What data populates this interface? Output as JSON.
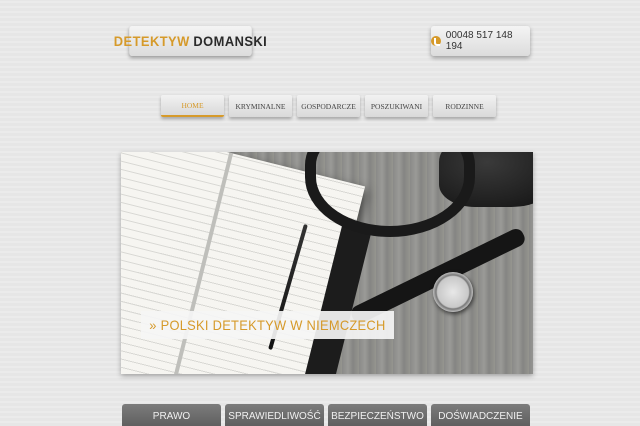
{
  "header": {
    "logo_part1": "DETEKTYW",
    "logo_part2": "DOMANSKI",
    "phone": "00048 517 148 194"
  },
  "nav": {
    "items": [
      {
        "label": "HOME",
        "active": true
      },
      {
        "label": "KRYMINALNE"
      },
      {
        "label": "GOSPODARCZE"
      },
      {
        "label": "POSZUKIWANI"
      },
      {
        "label": "RODZINNE"
      }
    ]
  },
  "hero": {
    "caption": "» POLSKI DETEKTYW W NIEMCZECH"
  },
  "bottom_nav": {
    "items": [
      "PRAWO",
      "SPRAWIEDLIWOŚĆ",
      "BEZPIECZEŃSTWO",
      "DOŚWIADCZENIE"
    ]
  },
  "colors": {
    "accent": "#d69a2a",
    "bottom_tab": "#6a6a6a"
  }
}
